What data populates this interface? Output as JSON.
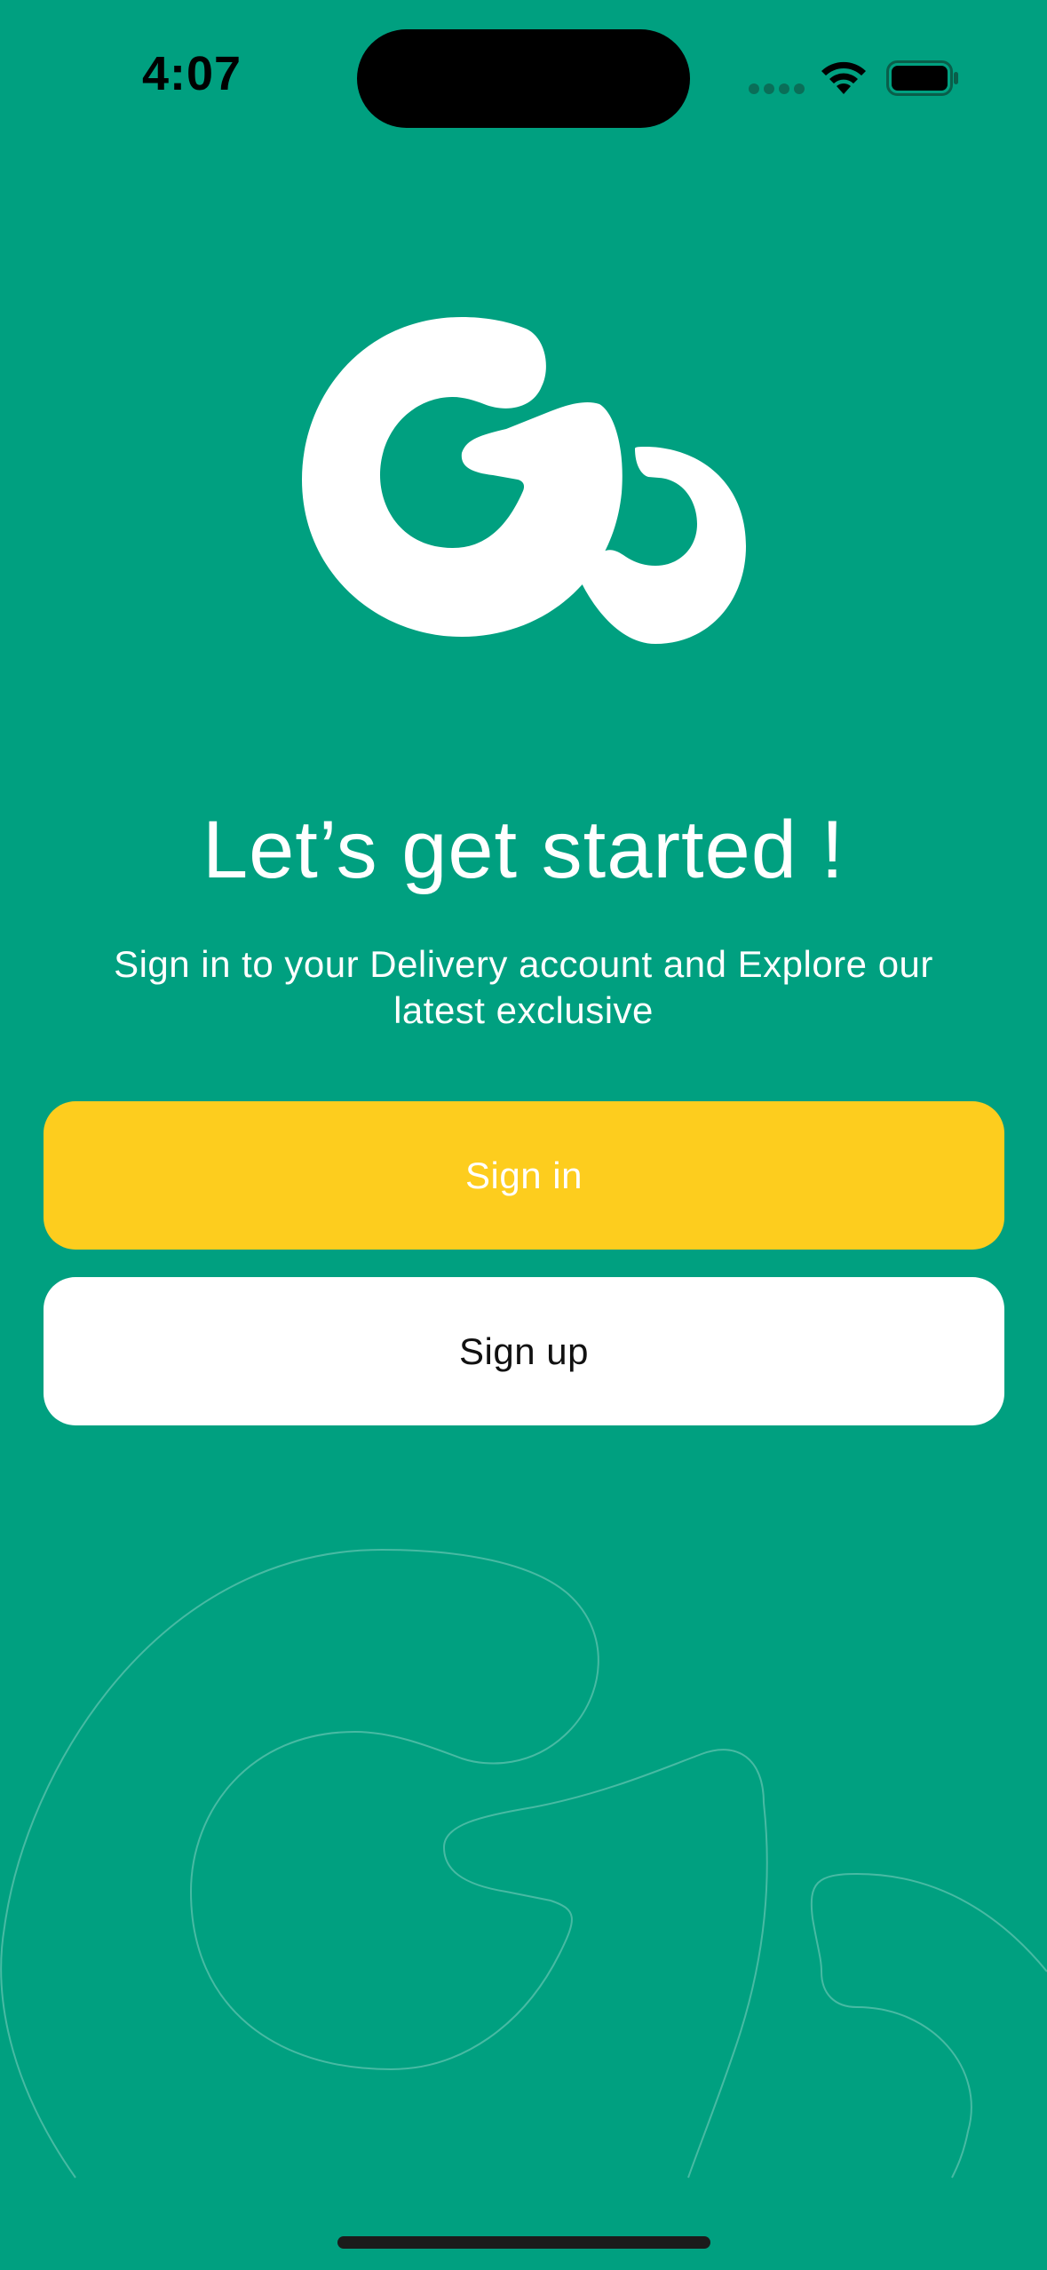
{
  "status_bar": {
    "time": "4:07",
    "icons": [
      "cellular-signal-icon",
      "wifi-icon",
      "battery-icon"
    ]
  },
  "brand": {
    "logo_icon": "go-logo-icon",
    "background_color": "#00A080",
    "accent_color": "#FDCD1E"
  },
  "welcome": {
    "headline": "Let’s get started !",
    "subtitle": "Sign in to your Delivery account and Explore our latest exclusive"
  },
  "actions": {
    "sign_in_label": "Sign in",
    "sign_up_label": "Sign up"
  }
}
